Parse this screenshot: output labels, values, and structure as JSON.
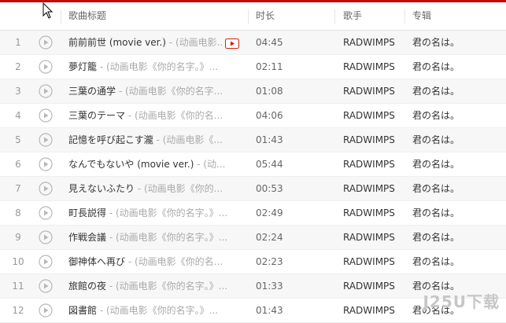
{
  "header": {
    "title_col": "歌曲标题",
    "duration_col": "时长",
    "artist_col": "歌手",
    "album_col": "专辑"
  },
  "colors": {
    "accent": "#c20c0c",
    "mv_icon": "#d81e06"
  },
  "rows": [
    {
      "num": "1",
      "title": "前前前世 (movie ver.)",
      "sub": " - (动画电影...",
      "mv": true,
      "duration": "04:45",
      "artist": "RADWIMPS",
      "album": "君の名は。"
    },
    {
      "num": "2",
      "title": "夢灯籠",
      "sub": " - (动画电影《你的名字。》...",
      "mv": false,
      "duration": "02:11",
      "artist": "RADWIMPS",
      "album": "君の名は。"
    },
    {
      "num": "3",
      "title": "三葉の通学",
      "sub": " - (动画电影《你的名字...",
      "mv": false,
      "duration": "01:08",
      "artist": "RADWIMPS",
      "album": "君の名は。"
    },
    {
      "num": "4",
      "title": "三葉のテーマ",
      "sub": " - (动画电影《你的名...",
      "mv": false,
      "duration": "04:06",
      "artist": "RADWIMPS",
      "album": "君の名は。"
    },
    {
      "num": "5",
      "title": "記憶を呼び起こす瀧",
      "sub": " - (动画电影《...",
      "mv": false,
      "duration": "01:43",
      "artist": "RADWIMPS",
      "album": "君の名は。"
    },
    {
      "num": "6",
      "title": "なんでもないや (movie ver.)",
      "sub": " - (动...",
      "mv": false,
      "duration": "05:44",
      "artist": "RADWIMPS",
      "album": "君の名は。"
    },
    {
      "num": "7",
      "title": "見えないふたり",
      "sub": " - (动画电影《你的...",
      "mv": false,
      "duration": "00:53",
      "artist": "RADWIMPS",
      "album": "君の名は。"
    },
    {
      "num": "8",
      "title": "町長説得",
      "sub": " - (动画电影《你的名字。》...",
      "mv": false,
      "duration": "02:49",
      "artist": "RADWIMPS",
      "album": "君の名は。"
    },
    {
      "num": "9",
      "title": "作戦会議",
      "sub": " - (动画电影《你的名字。》...",
      "mv": false,
      "duration": "02:24",
      "artist": "RADWIMPS",
      "album": "君の名は。"
    },
    {
      "num": "10",
      "title": "御神体へ再び",
      "sub": " - (动画电影《你的名...",
      "mv": false,
      "duration": "02:23",
      "artist": "RADWIMPS",
      "album": "君の名は。"
    },
    {
      "num": "11",
      "title": "旅館の夜",
      "sub": " - (动画电影《你的名字。》...",
      "mv": false,
      "duration": "01:33",
      "artist": "RADWIMPS",
      "album": "君の名は。"
    },
    {
      "num": "12",
      "title": "図書館",
      "sub": " - (动画电影《你的名字。》...",
      "mv": false,
      "duration": "01:43",
      "artist": "RADWIMPS",
      "album": "君の名は。"
    }
  ],
  "watermark": "J25U下载"
}
